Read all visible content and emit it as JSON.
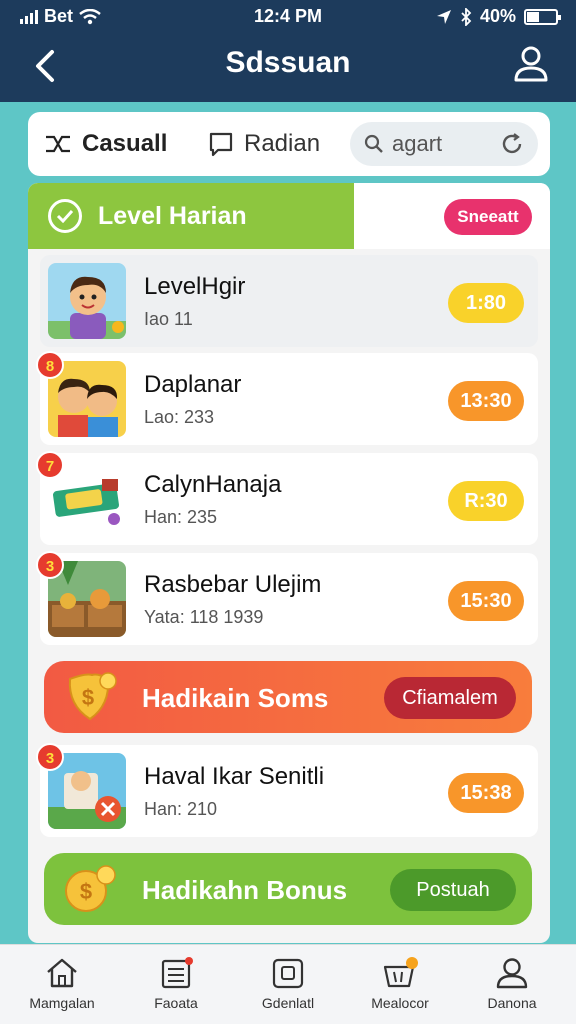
{
  "status": {
    "carrier": "Bet",
    "time": "12:4 PM",
    "battery": "40%"
  },
  "header": {
    "title": "Sdssuan"
  },
  "filters": {
    "casual": "Casuall",
    "radian": "Radian",
    "search_placeholder": "agart"
  },
  "level": {
    "title": "Level Harian",
    "button": "Sneeatt"
  },
  "games": [
    {
      "title": "LevelHgir",
      "sub": "Iao 11",
      "badge": "",
      "time": "1:80",
      "time_color": "yellow"
    },
    {
      "title": "Daplanar",
      "sub": "Lao: 233",
      "badge": "8",
      "time": "13:30",
      "time_color": "orange"
    },
    {
      "title": "CalynHanaja",
      "sub": "Han: 235",
      "badge": "7",
      "time": "R:30",
      "time_color": "yellow"
    },
    {
      "title": "Rasbebar Ulejim",
      "sub": "Yata: 118 1939",
      "badge": "3",
      "time": "15:30",
      "time_color": "orange"
    },
    {
      "title": "Haval Ikar Senitli",
      "sub": "Han: 210",
      "badge": "3",
      "time": "15:38",
      "time_color": "orange"
    }
  ],
  "bonus": [
    {
      "title": "Hadikain Soms",
      "button": "Cfiamalem"
    },
    {
      "title": "Hadikahn Bonus",
      "button": "Postuah"
    }
  ],
  "nav": [
    {
      "label": "Mamgalan",
      "icon": "home-icon"
    },
    {
      "label": "Faoata",
      "icon": "list-icon"
    },
    {
      "label": "Gdenlatl",
      "icon": "tablet-icon"
    },
    {
      "label": "Mealocor",
      "icon": "basket-icon"
    },
    {
      "label": "Danona",
      "icon": "profile-icon"
    }
  ]
}
